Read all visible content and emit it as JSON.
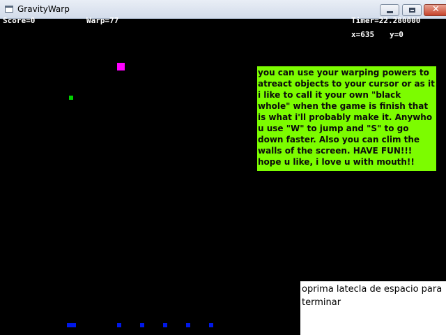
{
  "window": {
    "title": "GravityWarp",
    "icons": {
      "app": "window-app-icon",
      "minimize": "minimize-icon",
      "maximize": "maximize-icon",
      "close": "close-icon"
    }
  },
  "hud": {
    "score": "Score=0",
    "warp": "Warp=77",
    "timer": "Timer=22.280000",
    "x": "x=635",
    "y": "y=0"
  },
  "colors": {
    "background": "#000000",
    "player": "#ff00ff",
    "pickup": "#00d000",
    "ground_blocks": "#0018e8",
    "message_box": "#7cfc00",
    "footer_box": "#ffffff"
  },
  "messages": {
    "instructions": "you can use your warping powers to atreact objects to your cursor or as it i like to call it your own \"black whole\" when the game is finish that is what i'll probably make it. Anywho u use \"W\" to jump and \"S\" to go down faster. Also you can clim the walls of the screen. HAVE FUN!!! hope u like, i love u with mouth!!",
    "quit_hint": "oprima latecla de espacio para terminar"
  }
}
